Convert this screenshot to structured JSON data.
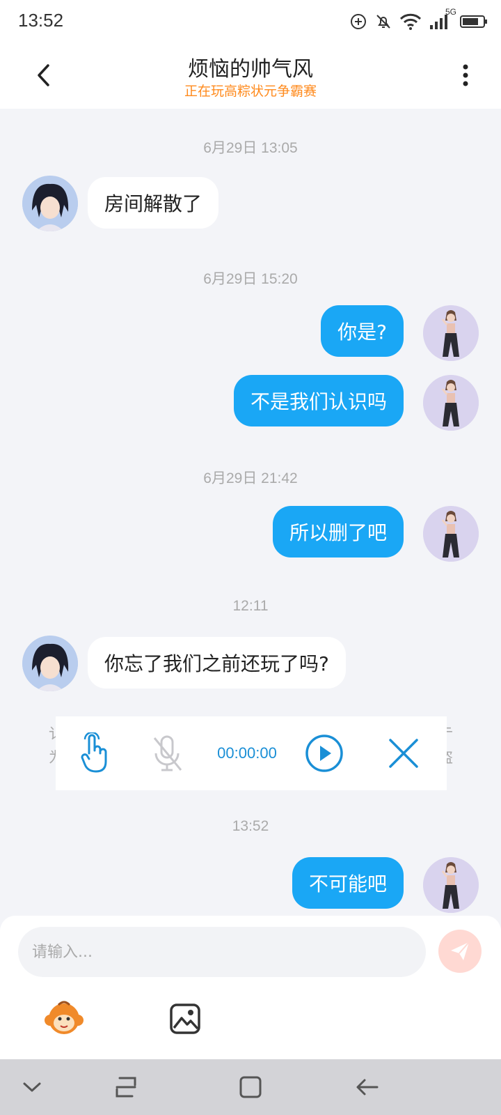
{
  "status_bar": {
    "time": "13:52",
    "network_label": "5G",
    "icons": [
      "add-circle-icon",
      "bell-muted-icon",
      "wifi-icon",
      "signal-icon",
      "battery-icon"
    ]
  },
  "header": {
    "title": "烦恼的帅气风",
    "subtitle": "正在玩高粽状元争霸赛",
    "subtitle_color": "#ff8a1c"
  },
  "messages": [
    {
      "type": "time",
      "text": "6月29日 13:05"
    },
    {
      "type": "msg",
      "side": "in",
      "text": "房间解散了"
    },
    {
      "type": "time",
      "text": "6月29日 15:20"
    },
    {
      "type": "msg",
      "side": "out",
      "text": "你是?"
    },
    {
      "type": "msg",
      "side": "out",
      "text": "不是我们认识吗"
    },
    {
      "type": "time",
      "text": "6月29日 21:42"
    },
    {
      "type": "msg",
      "side": "out",
      "text": "所以删了吧"
    },
    {
      "type": "time",
      "text": "12:11"
    },
    {
      "type": "msg",
      "side": "in",
      "text": "你忘了我们之前还玩了吗?"
    },
    {
      "type": "time",
      "text": "13:52"
    },
    {
      "type": "msg",
      "side": "out",
      "text": "不可能吧"
    }
  ],
  "partial_notice": {
    "left_lines": [
      "讠",
      "为"
    ],
    "right_lines": [
      "亍",
      "盗"
    ]
  },
  "voice_panel": {
    "timer": "00:00:00",
    "icons": [
      "hand-tap-icon",
      "mic-off-icon",
      "play-icon",
      "close-icon"
    ]
  },
  "input": {
    "placeholder": "请输入...",
    "value": ""
  },
  "colors": {
    "accent": "#1aa7f5",
    "out_bubble": "#1aa7f5",
    "in_bubble": "#ffffff",
    "background": "#f3f4f8",
    "voice_icon": "#1a8fd6"
  }
}
